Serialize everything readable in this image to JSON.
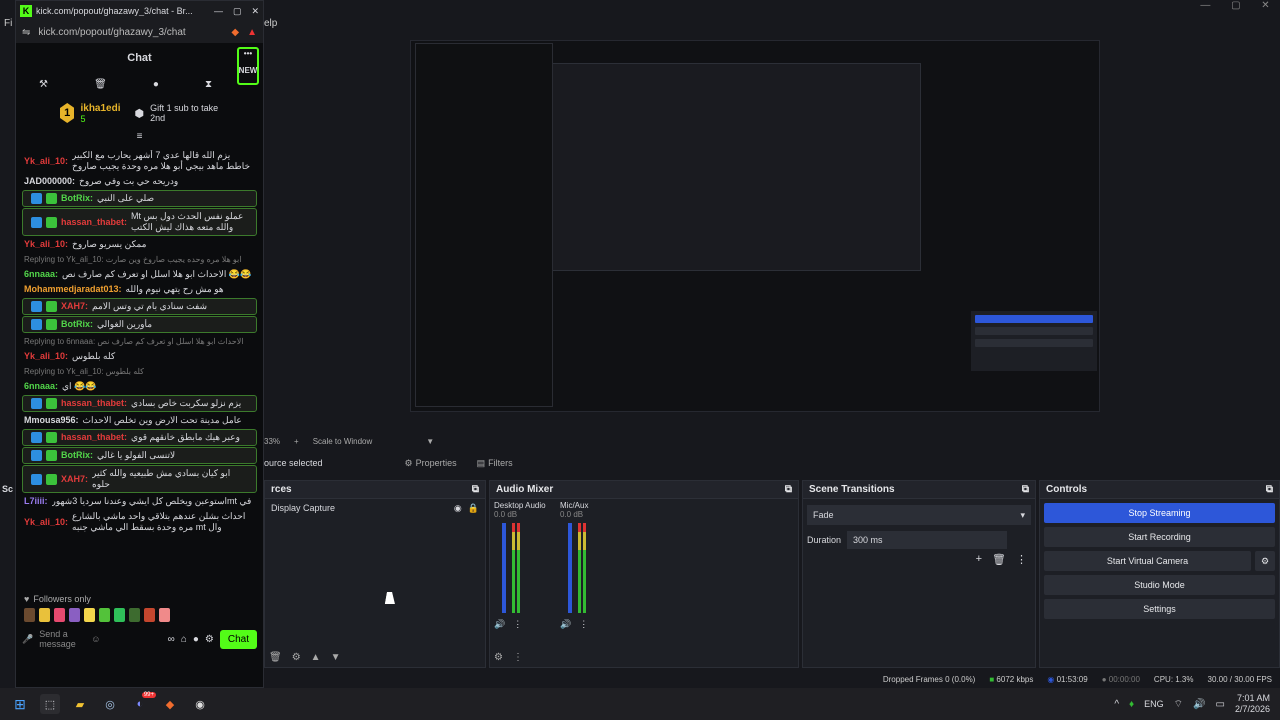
{
  "obs": {
    "menu": {
      "help": "elp",
      "file": "Fi"
    },
    "preview": {
      "zoom": "33%",
      "scale_label": "Scale to Window"
    },
    "source_bar": {
      "status": "ource selected",
      "properties": "Properties",
      "filters": "Filters"
    },
    "sources": {
      "title": "rces",
      "item": "Display Capture"
    },
    "audio_mixer": {
      "title": "Audio Mixer",
      "channels": [
        {
          "name": "Desktop Audio",
          "db": "0.0 dB"
        },
        {
          "name": "Mic/Aux",
          "db": "0.0 dB"
        }
      ],
      "scale": [
        "0",
        "-5",
        "-10",
        "-15",
        "-20",
        "-25",
        "-30",
        "-35",
        "-40",
        "-45",
        "-50",
        "-55",
        "-60"
      ]
    },
    "transitions": {
      "title": "Scene Transitions",
      "type": "Fade",
      "duration_label": "Duration",
      "duration": "300 ms"
    },
    "controls": {
      "title": "Controls",
      "stop_streaming": "Stop Streaming",
      "start_recording": "Start Recording",
      "start_virtual_camera": "Start Virtual Camera",
      "studio_mode": "Studio Mode",
      "settings": "Settings"
    },
    "statusbar": {
      "dropped": "Dropped Frames 0 (0.0%)",
      "bitrate": "6072 kbps",
      "stream_time": "01:53:09",
      "rec_time": "00:00:00",
      "cpu": "CPU: 1.3%",
      "fps": "30.00 / 30.00 FPS"
    },
    "left_edge": {
      "scenes": "Sc"
    }
  },
  "browser": {
    "title": "kick.com/popout/ghazawy_3/chat - Br...",
    "url": "kick.com/popout/ghazawy_3/chat",
    "chat_title": "Chat",
    "new_badge": "NEW",
    "pinned": {
      "user": "ikha1edi",
      "count": "5",
      "gift": "Gift 1 sub to take 2nd"
    },
    "messages": [
      {
        "user": "Yk_ali_10:",
        "text": "يزم الله قالها عدي 7 أشهر يحارب مع الكبير خاطط ماهد بيجي أبو هلا مره وحدة يجيب صاروخ وين صارت 😂",
        "color": "#e23b3b",
        "hl": false
      },
      {
        "user": "JAD000000:",
        "text": "ودريحه حي بت وفي صروخ",
        "color": "#d8d9de",
        "hl": false
      },
      {
        "user": "BotRix:",
        "text": "صلي على النبي",
        "color": "#52d64a",
        "hl": true
      },
      {
        "user": "hassan_thabet:",
        "text": "Mt عملو نفس الحدث دول بس والله متعه هذاك ليش الكتب",
        "color": "#e23b3b",
        "hl": true
      },
      {
        "user": "Yk_ali_10:",
        "text": "ممكن يسريو صاروخ",
        "color": "#e23b3b",
        "hl": false
      },
      {
        "user": "6nnaaa:",
        "text": "الاحداث ابو هلا اسلل او تعرف كم صارف نص 😂😂",
        "color": "#52d64a",
        "hl": false,
        "reply": "Replying to Yk_ali_10: ابو هلا مره وحده يجيب صاروخ وين صارت"
      },
      {
        "user": "Mohammedjaradat013:",
        "text": "هو مش رح يتهي نيوم والله",
        "color": "#f0a030",
        "hl": false
      },
      {
        "user": "XAH7:",
        "text": "شفت سنادي بام تي وتس الامم",
        "color": "#e23b3b",
        "hl": true
      },
      {
        "user": "BotRix:",
        "text": "مأورين الغوالي",
        "color": "#52d64a",
        "hl": true
      },
      {
        "user": "Yk_ali_10:",
        "text": "كله بلطوس",
        "color": "#e23b3b",
        "hl": false,
        "reply": "Replying to 6nnaaa: الاحداث ابو هلا اسلل او تعرف كم صارف نص"
      },
      {
        "user": "6nnaaa:",
        "text": "اي 😂😂",
        "color": "#52d64a",
        "hl": false,
        "reply": "Replying to Yk_ali_10: كله بلطوس"
      },
      {
        "user": "hassan_thabet:",
        "text": "يزم نزلو سكربت خاص بسادي",
        "color": "#e23b3b",
        "hl": true
      },
      {
        "user": "Mmousa956:",
        "text": "عامل مدينة تحت الارض وين تخلص الاحداث",
        "color": "#d8d9de",
        "hl": false
      },
      {
        "user": "hassan_thabet:",
        "text": "وعبر هيك مابطق خانقهم قوي",
        "color": "#e23b3b",
        "hl": true
      },
      {
        "user": "BotRix:",
        "text": "لاتنسى الفولو يا غالي",
        "color": "#52d64a",
        "hl": true
      },
      {
        "user": "XAH7:",
        "text": "ابو كيان بسادي مش طبيعيه والله كثير حلوه",
        "color": "#e23b3b",
        "hl": true
      },
      {
        "user": "L7iiii:",
        "text": "استوعبن ويخلص كل ايشي وعندنا سرديا 3شهورmt في",
        "color": "#9a7cf0",
        "hl": false
      },
      {
        "user": "Yk_ali_10:",
        "text": "احداث بشلن عندهم بتلاقي واحد ماشي بالشارع مره وحدة بسقط الي ماشي جنبه mt وال",
        "color": "#e23b3b",
        "hl": false
      }
    ],
    "followers_only": "Followers only",
    "send_placeholder": "Send a message",
    "chat_button": "Chat"
  },
  "taskbar": {
    "lang": "ENG",
    "time": "7:01 AM",
    "date": "2/7/2026",
    "badge": "99+"
  },
  "colors": {
    "accent": "#2d57d9",
    "kick_green": "#53fc18",
    "obs_bg": "#1d1f25"
  }
}
